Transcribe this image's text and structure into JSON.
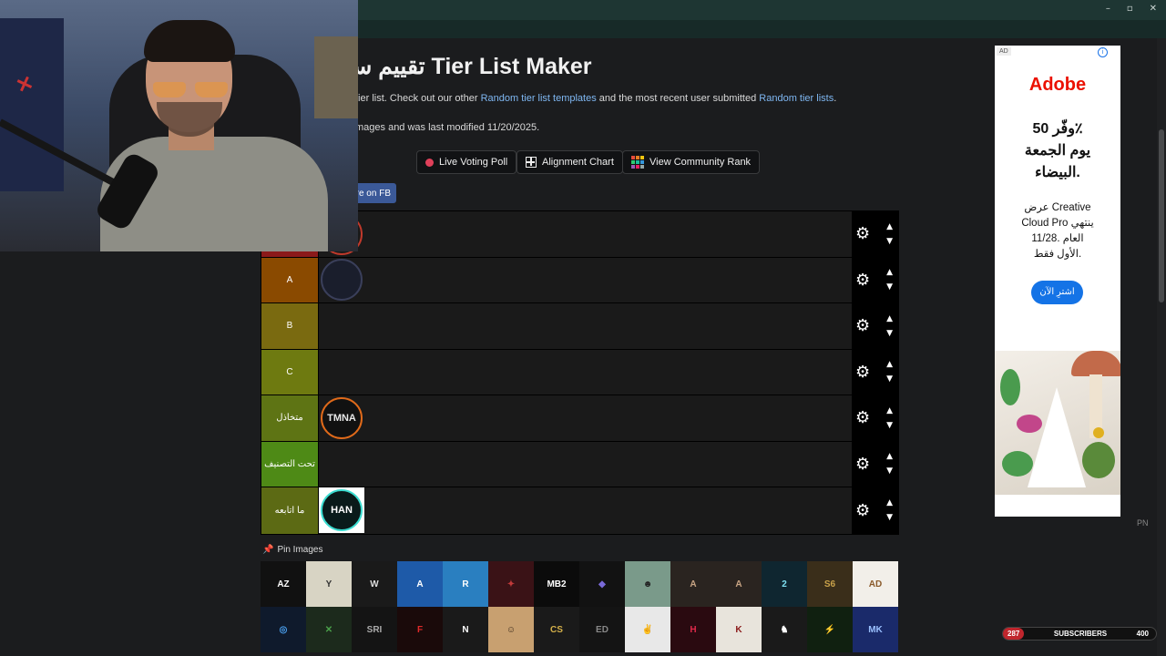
{
  "window": {
    "controls": [
      "–",
      "▫",
      "✕"
    ]
  },
  "title": "تقييم سـ Tier List Maker",
  "intro": {
    "pre": "tier list. Check out our other ",
    "link1": "Random tier list templates",
    "mid": " and the most recent user submitted ",
    "link2": "Random tier lists",
    "post": "."
  },
  "meta": "mages and was last modified 11/20/2025.",
  "buttons": {
    "live_poll": "Live Voting Poll",
    "alignment": "Alignment Chart",
    "community": "View Community Rank",
    "share_fb": "re on FB"
  },
  "tiers": [
    {
      "label": "",
      "color": "#8b1a1a",
      "items": [
        "red-ring-logo"
      ]
    },
    {
      "label": "A",
      "color": "#8a4a00",
      "items": [
        "wolf-logo"
      ]
    },
    {
      "label": "B",
      "color": "#7a6a10",
      "items": []
    },
    {
      "label": "C",
      "color": "#6e7a10",
      "items": []
    },
    {
      "label": "متخاذل",
      "color": "#5e7414",
      "items": [
        "tmna-logo"
      ]
    },
    {
      "label": "تحت التصنيف",
      "color": "#4e8a16",
      "items": []
    },
    {
      "label": "ما اتابعه",
      "color": "#5c6a14",
      "items": [
        "han-logo"
      ]
    }
  ],
  "item_text": {
    "red-ring-logo": "",
    "wolf-logo": "",
    "tmna-logo": "TMNA",
    "han-logo": "HAN"
  },
  "pin_label": "Pin Images",
  "pool": [
    {
      "text": "AZ",
      "bg": "#111111",
      "fg": "#ffffff"
    },
    {
      "text": "Y",
      "bg": "#d8d4c4",
      "fg": "#333333"
    },
    {
      "text": "W",
      "bg": "#1a1a1a",
      "fg": "#dddddd"
    },
    {
      "text": "A",
      "bg": "#1e5aa8",
      "fg": "#ffffff"
    },
    {
      "text": "R",
      "bg": "#2a7fc0",
      "fg": "#ffffff"
    },
    {
      "text": "✦",
      "bg": "#3a1216",
      "fg": "#c23a3a"
    },
    {
      "text": "MB2",
      "bg": "#0b0b0b",
      "fg": "#ffffff"
    },
    {
      "text": "◆",
      "bg": "#121212",
      "fg": "#7a6ad8"
    },
    {
      "text": "☻",
      "bg": "#7a9a8a",
      "fg": "#222222"
    },
    {
      "text": "A",
      "bg": "#2a2420",
      "fg": "#c9a584"
    },
    {
      "text": "A",
      "bg": "#2a2420",
      "fg": "#c9a584"
    },
    {
      "text": "2",
      "bg": "#0f2630",
      "fg": "#7fe1f2"
    },
    {
      "text": "S6",
      "bg": "#3a2e1a",
      "fg": "#c9a24a"
    },
    {
      "text": "AD",
      "bg": "#f2efe9",
      "fg": "#8a5a2a"
    },
    {
      "text": "◎",
      "bg": "#0f1a2c",
      "fg": "#4aa0f0"
    },
    {
      "text": "✕",
      "bg": "#1c2a1c",
      "fg": "#4aa04a"
    },
    {
      "text": "SRI",
      "bg": "#141414",
      "fg": "#aaaaaa"
    },
    {
      "text": "F",
      "bg": "#1a0a0a",
      "fg": "#e02a2a"
    },
    {
      "text": "N",
      "bg": "#1a1a1a",
      "fg": "#ffffff"
    },
    {
      "text": "☺",
      "bg": "#c8a070",
      "fg": "#3a2a1a"
    },
    {
      "text": "CS",
      "bg": "#1a1a1a",
      "fg": "#d4b04a"
    },
    {
      "text": "ED",
      "bg": "#141414",
      "fg": "#888888"
    },
    {
      "text": "✌",
      "bg": "#e8e8e8",
      "fg": "#333333"
    },
    {
      "text": "H",
      "bg": "#2a0a10",
      "fg": "#e02a4a"
    },
    {
      "text": "K",
      "bg": "#e8e4dc",
      "fg": "#8a1a1a"
    },
    {
      "text": "♞",
      "bg": "#1a1a1a",
      "fg": "#ffffff"
    },
    {
      "text": "⚡",
      "bg": "#102010",
      "fg": "#9cf24a"
    },
    {
      "text": "MK",
      "bg": "#1a2a6a",
      "fg": "#9ac0ff"
    }
  ],
  "ad": {
    "tag": "AD",
    "info": "i",
    "brand": "Adobe",
    "headline_lines": [
      "وفّر 50٪",
      "يوم الجمعة",
      "البيضاء."
    ],
    "body_lines": [
      "عرض Creative",
      "Cloud Pro ينتهي",
      "11/28. العام",
      "الأول فقط."
    ],
    "cta": "اشترِ الآن",
    "color": "#eb1000"
  },
  "pn": "PN",
  "subs": {
    "count_left": "287",
    "label": "SUBSCRIBERS",
    "count_right": "400"
  }
}
